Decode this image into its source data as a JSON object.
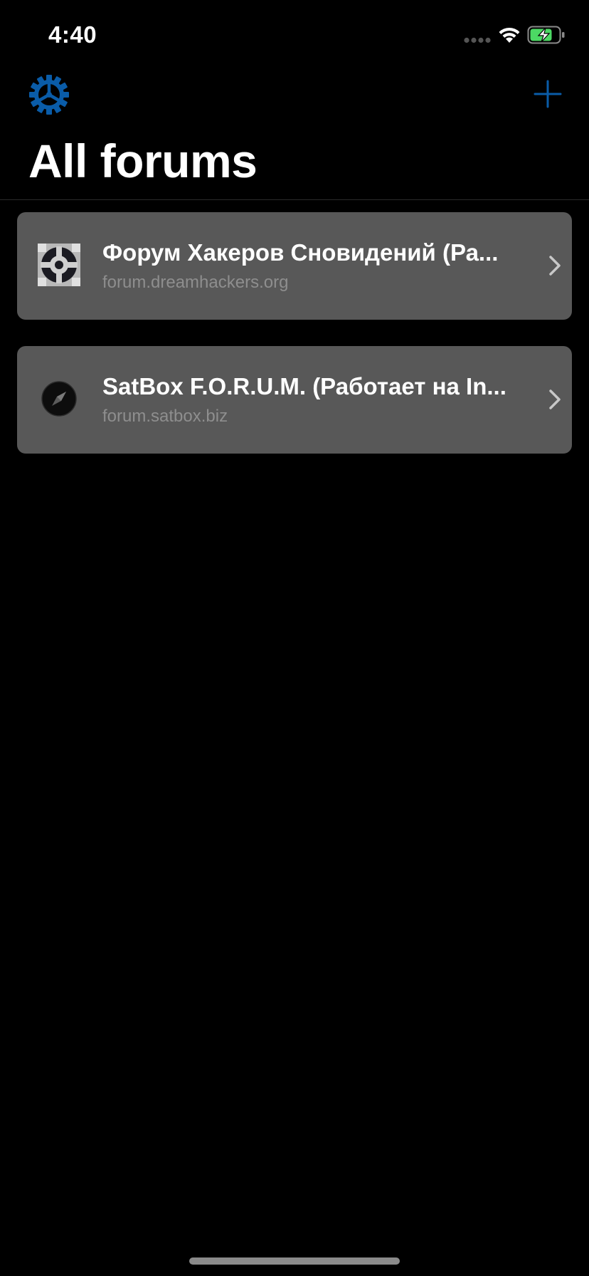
{
  "status_bar": {
    "time": "4:40",
    "signal_icon": "signal-dots-icon",
    "wifi_icon": "wifi-icon",
    "battery_icon": "battery-charging-icon",
    "battery_color": "#4cd964"
  },
  "nav": {
    "settings_icon": "gear-icon",
    "add_icon": "plus-icon",
    "accent_color": "#0a5ca8",
    "title": "All forums"
  },
  "forums": [
    {
      "title": "Форум Хакеров Сновидений (Ра...",
      "url": "forum.dreamhackers.org",
      "icon": "dreamhackers-logo-icon"
    },
    {
      "title": "SatBox F.O.R.U.M. (Работает на In...",
      "url": "forum.satbox.biz",
      "icon": "compass-icon"
    }
  ],
  "colors": {
    "background": "#000000",
    "card": "#585858",
    "subtitle": "#8e8e8e"
  }
}
